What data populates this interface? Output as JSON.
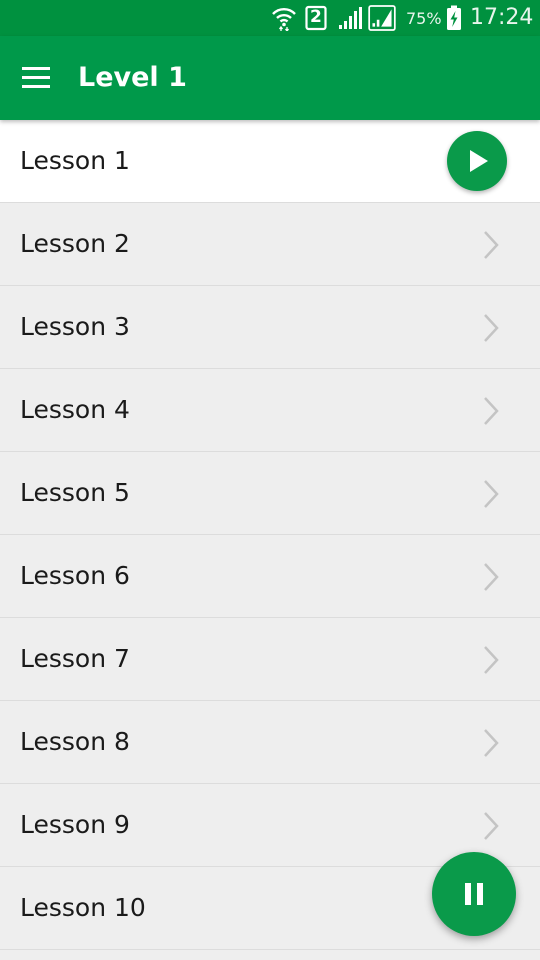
{
  "status_bar": {
    "sim_slot": "2",
    "battery_percent": "75%",
    "time": "17:24",
    "icons": [
      "wifi-icon",
      "sim-2-icon",
      "signal-icon",
      "signal-icon",
      "battery-charging-icon"
    ]
  },
  "app_bar": {
    "title": "Level 1",
    "menu_icon": "hamburger-menu-icon"
  },
  "lessons": [
    {
      "label": "Lesson 1",
      "active": true
    },
    {
      "label": "Lesson 2"
    },
    {
      "label": "Lesson 3"
    },
    {
      "label": "Lesson 4"
    },
    {
      "label": "Lesson 5"
    },
    {
      "label": "Lesson 6"
    },
    {
      "label": "Lesson 7"
    },
    {
      "label": "Lesson 8"
    },
    {
      "label": "Lesson 9"
    },
    {
      "label": "Lesson 10"
    }
  ],
  "fab": {
    "icon": "pause-icon"
  },
  "colors": {
    "status_bar": "#00913f",
    "app_bar": "#00994a",
    "accent": "#0a9a4a",
    "list_background": "#eeeeee",
    "active_row": "#ffffff",
    "chevron": "#c4c4c4"
  }
}
